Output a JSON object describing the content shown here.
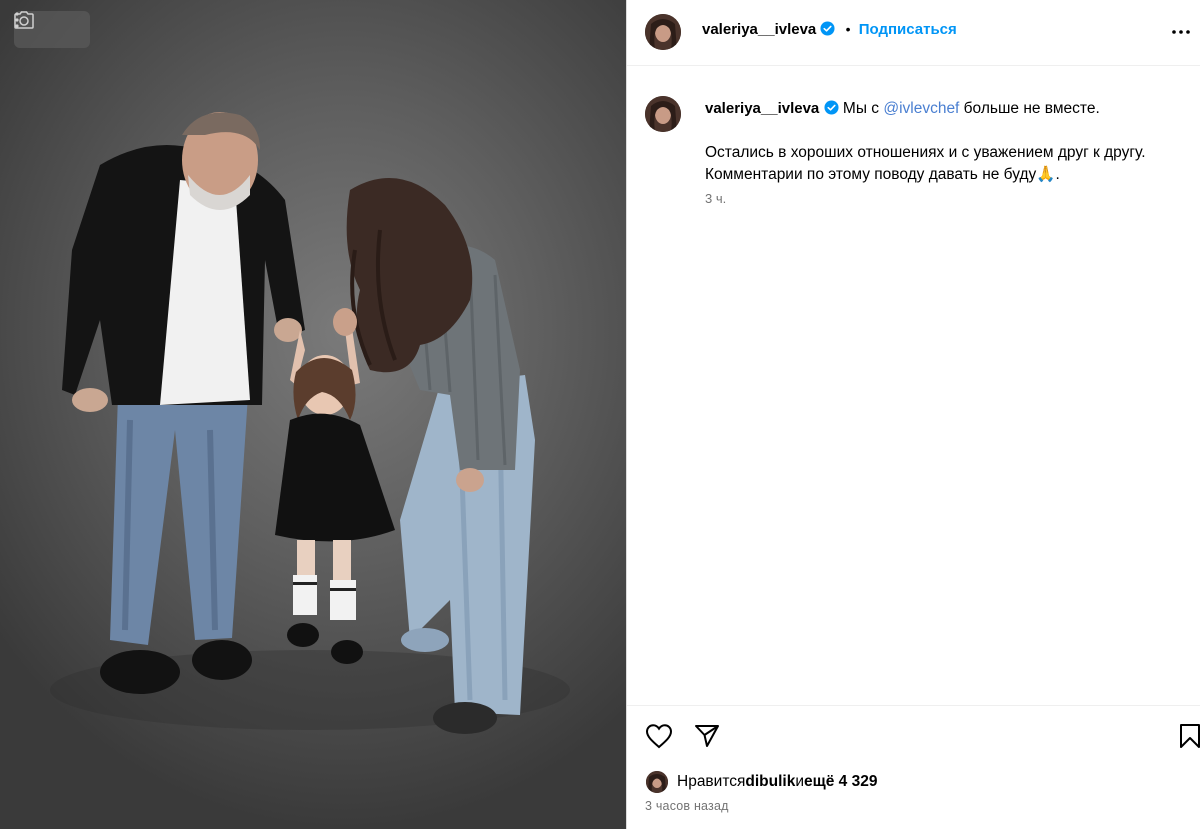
{
  "photo": {
    "alt": ""
  },
  "header": {
    "username": "valeriya__ivleva",
    "separator": "•",
    "follow_label": "Подписаться"
  },
  "caption": {
    "username": "valeriya__ivleva",
    "line1_prefix": "Мы с ",
    "mention": "@ivlevchef",
    "line1_suffix": " больше не вместе.",
    "line2": "Остались в хороших отношениях и с уважением друг к другу.",
    "line3": "Комментарии по этому поводу давать не буду🙏.",
    "time": "3 ч."
  },
  "actions": {
    "likes_prefix": "Нравится ",
    "likes_user": "dibulik",
    "likes_middle": " и ",
    "likes_count": "ещё 4 329",
    "post_time": "3 часов назад"
  },
  "colors": {
    "accent": "#0095f6",
    "mention": "#4a7fd1",
    "secondary_text": "#737373",
    "border": "#dbdbdb"
  },
  "icons": [
    "camera-icon",
    "kebab-icon",
    "verified-badge-icon",
    "more-icon",
    "heart-icon",
    "send-icon",
    "bookmark-icon"
  ]
}
